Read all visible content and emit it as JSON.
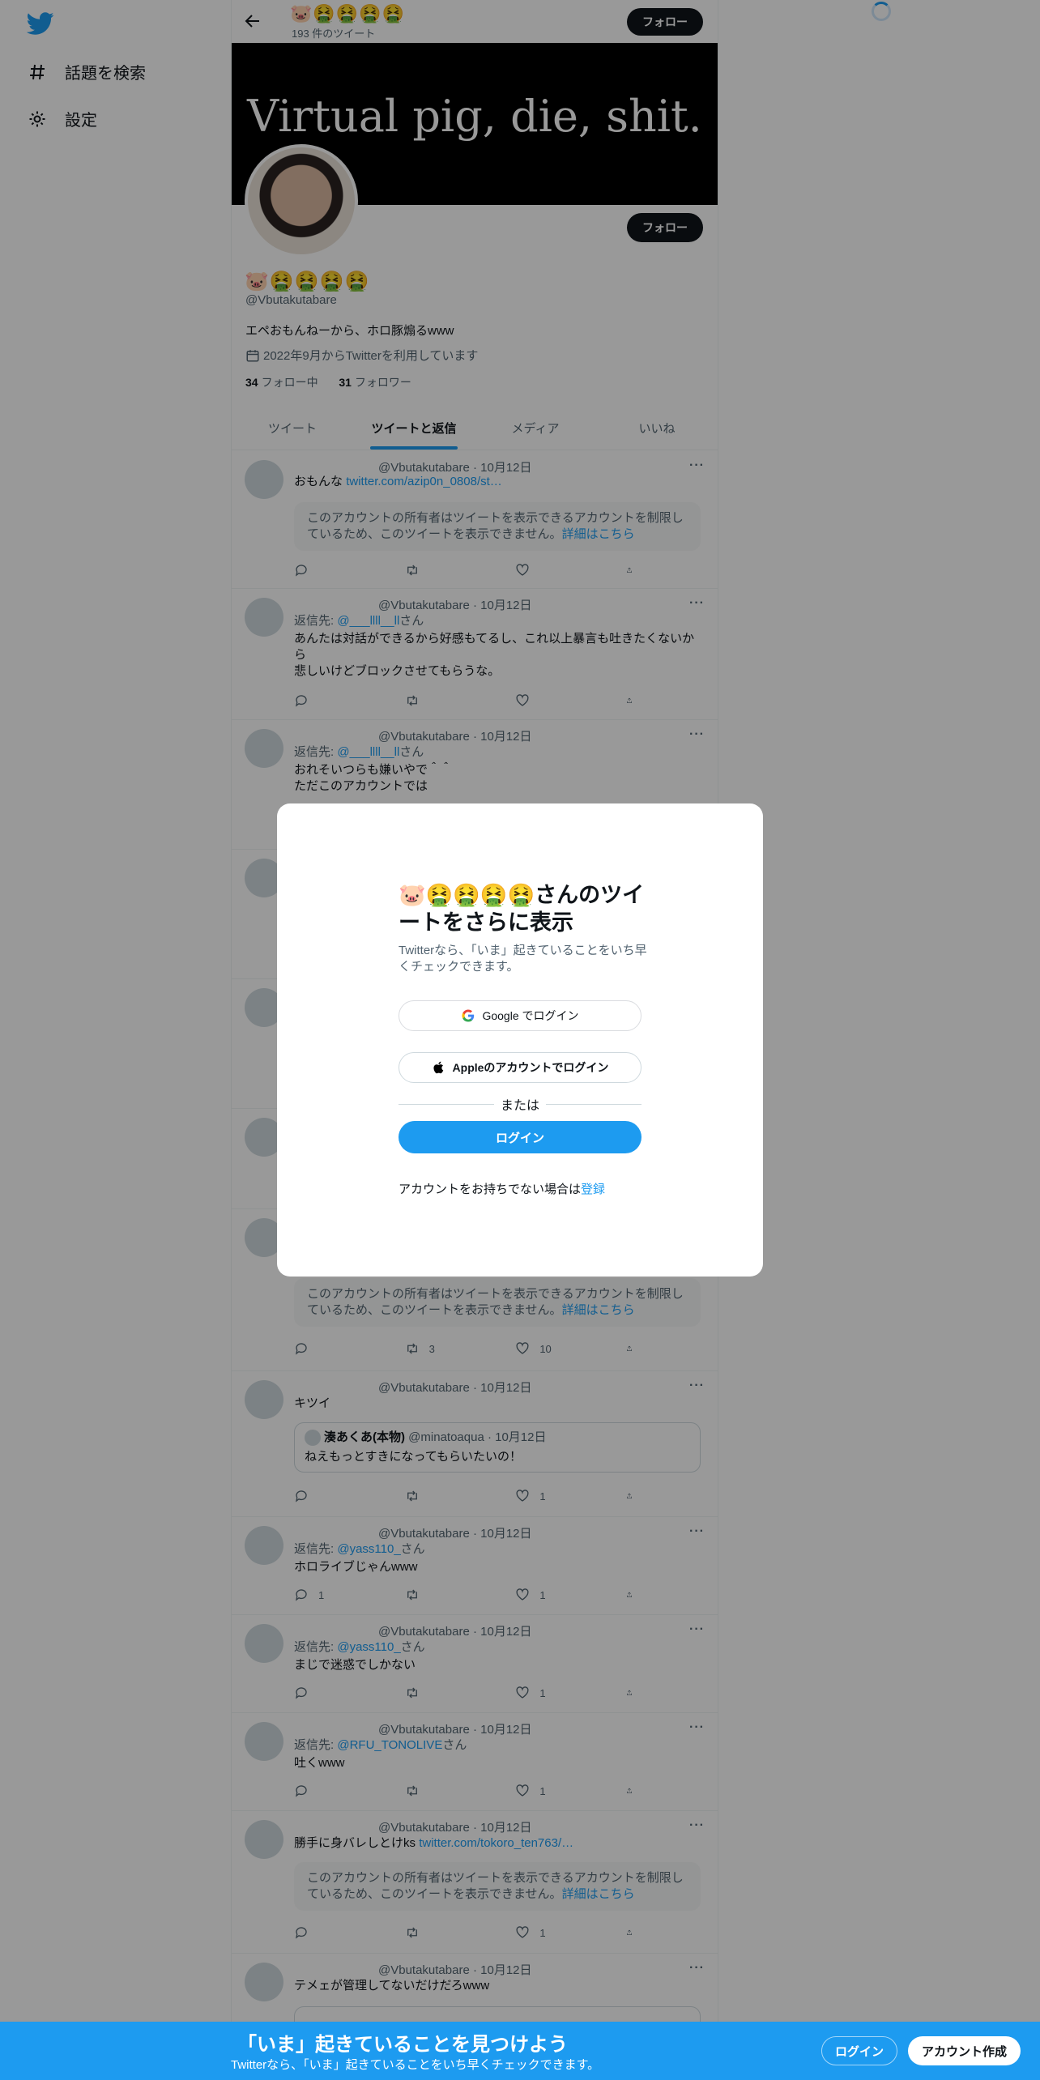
{
  "sidebar": {
    "logo": "twitter-bird-icon",
    "items": [
      {
        "label": "話題を検索",
        "icon": "hash-icon"
      },
      {
        "label": "設定",
        "icon": "gear-icon"
      }
    ]
  },
  "header": {
    "title": "🐷🤮🤮🤮🤮",
    "tweet_count": "193 件のツイート",
    "follow_label": "フォロー"
  },
  "profile": {
    "banner_text": "Virtual pig, die, shit.",
    "name": "🐷🤮🤮🤮🤮",
    "handle": "@Vbutakutabare",
    "bio": "エペおもんねーから、ホロ豚煽るwww",
    "joined": "2022年9月からTwitterを利用しています",
    "following_count": "34",
    "following_label": "フォロー中",
    "followers_count": "31",
    "followers_label": "フォロワー",
    "follow_label": "フォロー"
  },
  "tabs": [
    "ツイート",
    "ツイートと返信",
    "メディア",
    "いいね"
  ],
  "tweets": [
    {
      "header": "@Vbutakutabare · 10月12日",
      "text": "おもんな",
      "link": "twitter.com/azip0n_0808/st…",
      "notice": "このアカウントの所有者はツイートを表示できるアカウントを制限しているため、このツイートを表示できません。",
      "notice_link": "詳細はこちら"
    },
    {
      "header": "@Vbutakutabare · 10月12日",
      "reply_prefix": "返信先: ",
      "reply_to": "@___llll__ll",
      "reply_suffix": "さん",
      "text": "あんたは対話ができるから好感もてるし、これ以上暴言も吐きたくないから\n悲しいけどブロックさせてもらうな。"
    },
    {
      "header": "@Vbutakutabare · 10月12日",
      "reply_prefix": "返信先: ",
      "reply_to": "@___llll__ll",
      "reply_suffix": "さん",
      "text": "おれそいつらも嫌いやで＾＾\nただこのアカウントでは"
    },
    {
      "notice": "このアカウントの所有者はツイートを表示できるアカウントを制限しているため、このツイートを表示できません。",
      "notice_link": "詳細はこちら",
      "retweets": "3",
      "likes": "10"
    },
    {
      "header": "@Vbutakutabare · 10月12日",
      "text": "キツイ",
      "quote": {
        "name": "湊あくあ(本物)",
        "handle": "@minatoaqua · 10月12日",
        "text": "ねえもっとすきになってもらいたいの！"
      },
      "likes": "1"
    },
    {
      "header": "@Vbutakutabare · 10月12日",
      "reply_prefix": "返信先: ",
      "reply_to": "@yass110_",
      "reply_suffix": "さん",
      "text": "ホロライブじゃんwww",
      "replies": "1",
      "likes": "1"
    },
    {
      "header": "@Vbutakutabare · 10月12日",
      "reply_prefix": "返信先: ",
      "reply_to": "@yass110_",
      "reply_suffix": "さん",
      "text": "まじで迷惑でしかない",
      "likes": "1"
    },
    {
      "header": "@Vbutakutabare · 10月12日",
      "reply_prefix": "返信先: ",
      "reply_to": "@RFU_TONOLIVE",
      "reply_suffix": "さん",
      "text": "吐くwww",
      "likes": "1"
    },
    {
      "header": "@Vbutakutabare · 10月12日",
      "text": "勝手に身バレしとけks",
      "link": "twitter.com/tokoro_ten763/…",
      "notice": "このアカウントの所有者はツイートを表示できるアカウントを制限しているため、このツイートを表示できません。",
      "notice_link": "詳細はこちら",
      "likes": "1"
    },
    {
      "header": "@Vbutakutabare · 10月12日",
      "text": "テメェが管理してないだけだろwww"
    }
  ],
  "modal": {
    "title": "🐷🤮🤮🤮🤮さんのツイートをさらに表示",
    "subtitle": "Twitterなら、「いま」起きていることをいち早くチェックできます。",
    "google_label": "Google でログイン",
    "apple_label": "Appleのアカウントでログイン",
    "or_label": "または",
    "login_label": "ログイン",
    "signup_prefix": "アカウントをお持ちでない場合は",
    "signup_link": "登録"
  },
  "bottom_bar": {
    "title": "「いま」起きていることを見つけよう",
    "subtitle": "Twitterなら、「いま」起きていることをいち早くチェックできます。",
    "login_label": "ログイン",
    "signup_label": "アカウント作成"
  },
  "colors": {
    "accent": "#1d9bf0",
    "text": "#0f1419",
    "muted": "#536471"
  }
}
